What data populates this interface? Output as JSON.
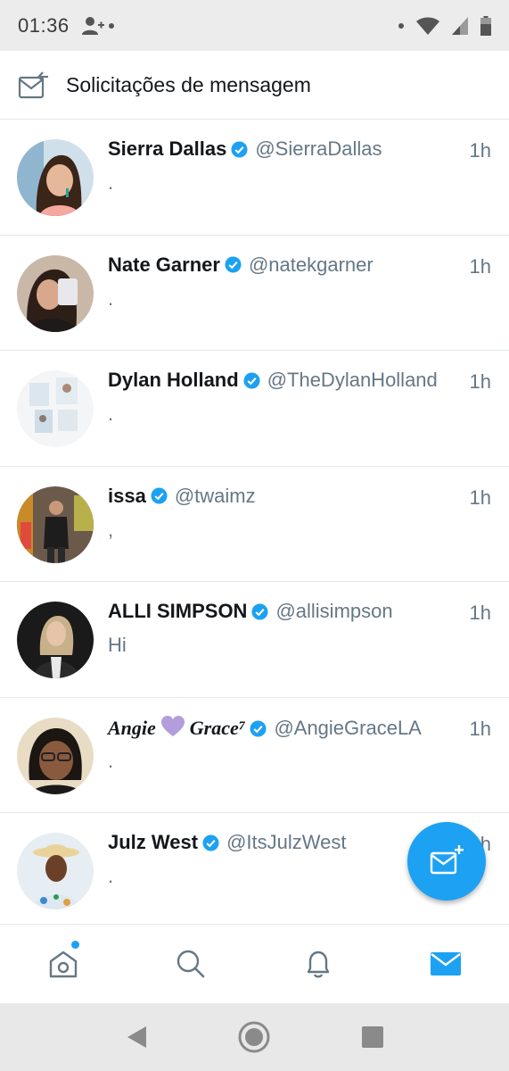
{
  "status_bar": {
    "time": "01:36",
    "icons": [
      "person-add-icon",
      "notification-dot-icon",
      "wifi-icon",
      "signal-icon",
      "battery-icon"
    ]
  },
  "header": {
    "icon": "message-request-icon",
    "title": "Solicitações de mensagem"
  },
  "conversations": [
    {
      "name": "Sierra Dallas",
      "handle": "@SierraDallas",
      "time": "1h",
      "message": ".",
      "verified": true
    },
    {
      "name": "Nate Garner",
      "handle": "@natekgarner",
      "time": "1h",
      "message": ".",
      "verified": true
    },
    {
      "name": "Dylan Holland",
      "handle": "@TheDylanHolland",
      "time": "1h",
      "message": ".",
      "verified": true
    },
    {
      "name": "issa",
      "handle": "@twaimz",
      "time": "1h",
      "message": ",",
      "verified": true
    },
    {
      "name": "ALLI SIMPSON",
      "handle": "@allisimpson",
      "time": "1h",
      "message": "Hi",
      "verified": true
    },
    {
      "name_part1": "Angie",
      "name_part2": "Grace⁷",
      "name_emoji": "purple-heart",
      "handle": "@AngieGraceLA",
      "time": "1h",
      "message": ".",
      "verified": true
    },
    {
      "name": "Julz West",
      "handle": "@ItsJulzWest",
      "time": "1h",
      "message": ".",
      "verified": true
    }
  ],
  "fab": {
    "icon": "new-message-icon"
  },
  "bottom_nav": {
    "items": [
      "home-icon",
      "search-icon",
      "notifications-icon",
      "messages-icon"
    ],
    "active": "messages-icon",
    "home_has_badge": true
  },
  "colors": {
    "accent": "#1da1f2",
    "secondary_text": "#657786",
    "primary_text": "#14171a",
    "divider": "#e1e8ed"
  }
}
